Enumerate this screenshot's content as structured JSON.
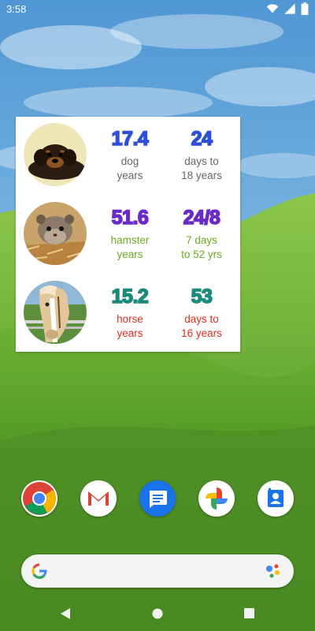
{
  "status_bar": {
    "time": "3:58"
  },
  "widget": {
    "pets": [
      {
        "animal": "dog",
        "age": "17.4",
        "age_label_line1": "dog",
        "age_label_line2": "years",
        "countdown": "24",
        "countdown_label_line1": "days to",
        "countdown_label_line2": "18 years",
        "color": "#2f4fd9",
        "label_color": "#666666"
      },
      {
        "animal": "hamster",
        "age": "51.6",
        "age_label_line1": "hamster",
        "age_label_line2": "years",
        "countdown": "24/8",
        "countdown_label_line1": "7 days",
        "countdown_label_line2": "to 52 yrs",
        "color": "#6a2bc9",
        "label_color": "#6aab1f"
      },
      {
        "animal": "horse",
        "age": "15.2",
        "age_label_line1": "horse",
        "age_label_line2": "years",
        "countdown": "53",
        "countdown_label_line1": "days to",
        "countdown_label_line2": "16 years",
        "color": "#1a8a7a",
        "label_color": "#e02c1c"
      }
    ]
  },
  "dock": {
    "apps": [
      {
        "name": "Chrome",
        "icon": "chrome-icon"
      },
      {
        "name": "Gmail",
        "icon": "gmail-icon"
      },
      {
        "name": "Messages",
        "icon": "messages-icon"
      },
      {
        "name": "Photos",
        "icon": "photos-icon"
      },
      {
        "name": "Contacts",
        "icon": "contacts-icon"
      }
    ]
  },
  "search": {
    "logo": "google-g-icon",
    "assistant": "assistant-icon"
  },
  "nav": {
    "back": "back-icon",
    "home": "home-icon",
    "recents": "recents-icon"
  }
}
